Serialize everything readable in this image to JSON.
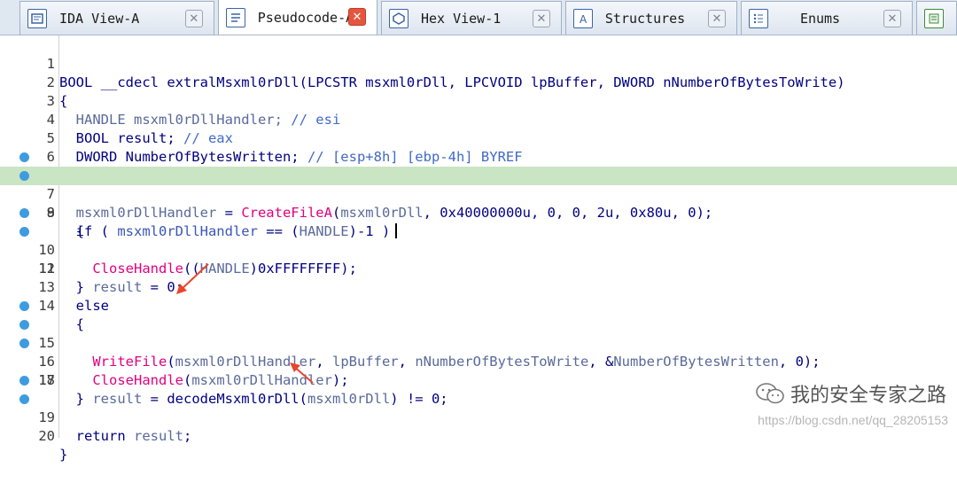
{
  "tabs": [
    {
      "label": "IDA View-A",
      "icon": "ida-view-icon",
      "active": false
    },
    {
      "label": "Pseudocode-A",
      "icon": "pseudocode-icon",
      "active": true
    },
    {
      "label": "Hex View-1",
      "icon": "hex-view-icon",
      "active": false
    },
    {
      "label": "Structures",
      "icon": "structures-icon",
      "active": false
    },
    {
      "label": "Enums",
      "icon": "enums-icon",
      "active": false
    }
  ],
  "code": {
    "lines": [
      {
        "num": "1",
        "dot": false
      },
      {
        "num": "2",
        "dot": false
      },
      {
        "num": "3",
        "dot": false
      },
      {
        "num": "4",
        "dot": false
      },
      {
        "num": "5",
        "dot": false
      },
      {
        "num": "6",
        "dot": false
      },
      {
        "num": "7",
        "dot": true
      },
      {
        "num": "8",
        "dot": true
      },
      {
        "num": "9",
        "dot": false
      },
      {
        "num": "10",
        "dot": true
      },
      {
        "num": "11",
        "dot": true
      },
      {
        "num": "12",
        "dot": false
      },
      {
        "num": "13",
        "dot": false
      },
      {
        "num": "14",
        "dot": false
      },
      {
        "num": "15",
        "dot": true
      },
      {
        "num": "16",
        "dot": true
      },
      {
        "num": "17",
        "dot": true
      },
      {
        "num": "18",
        "dot": false
      },
      {
        "num": "19",
        "dot": true
      },
      {
        "num": "20",
        "dot": true
      }
    ],
    "t": {
      "l1": "BOOL __cdecl extralMsxml0rDll(LPCSTR msxml0rDll, LPCVOID lpBuffer, DWORD nNumberOfBytesToWrite)",
      "l2": "{",
      "l3a": "  HANDLE msxml0rDllHandler; ",
      "l3b": "// esi",
      "l4a": "  BOOL result; ",
      "l4b": "// eax",
      "l5a": "  DWORD NumberOfBytesWritten; ",
      "l5b": "// [esp+8h] [ebp-4h] BYREF",
      "l7a": "  msxml0rDllHandler",
      "l7b": " = ",
      "l7c": "CreateFileA",
      "l7d": "(",
      "l7e": "msxml0rDll",
      "l7f": ", 0x40000000u, 0, 0, 2u, 0x80u, 0);",
      "l8a": "  if ( ",
      "l8b": "msxml0rDllHandler",
      "l8c": " == (",
      "l8d": "HANDLE",
      "l8e": ")-1 )",
      "l9": "  {",
      "l10a": "    ",
      "l10b": "CloseHandle",
      "l10c": "((",
      "l10d": "HANDLE",
      "l10e": ")0xFFFFFFFF);",
      "l11a": "    ",
      "l11b": "result",
      "l11c": " = 0;",
      "l12": "  }",
      "l13": "  else",
      "l14": "  {",
      "l15a": "    ",
      "l15b": "WriteFile",
      "l15c": "(",
      "l15d": "msxml0rDllHandler",
      "l15e": ", ",
      "l15f": "lpBuffer",
      "l15g": ", ",
      "l15h": "nNumberOfBytesToWrite",
      "l15i": ", &",
      "l15j": "NumberOfBytesWritten",
      "l15k": ", 0);",
      "l16a": "    ",
      "l16b": "CloseHandle",
      "l16c": "(",
      "l16d": "msxml0rDllHandler",
      "l16e": ");",
      "l17a": "    ",
      "l17b": "result",
      "l17c": " = decodeMsxml0rDll(",
      "l17d": "msxml0rDll",
      "l17e": ") != 0;",
      "l18": "  }",
      "l19a": "  return ",
      "l19b": "result",
      "l19c": ";",
      "l20": "}"
    }
  },
  "watermark": {
    "title": "我的安全专家之路",
    "url": "https://blog.csdn.net/qq_28205153"
  },
  "colors": {
    "highlight_line": "#c9e5c4",
    "function_call": "#e0007f",
    "annotation_arrow": "#e8452c"
  }
}
